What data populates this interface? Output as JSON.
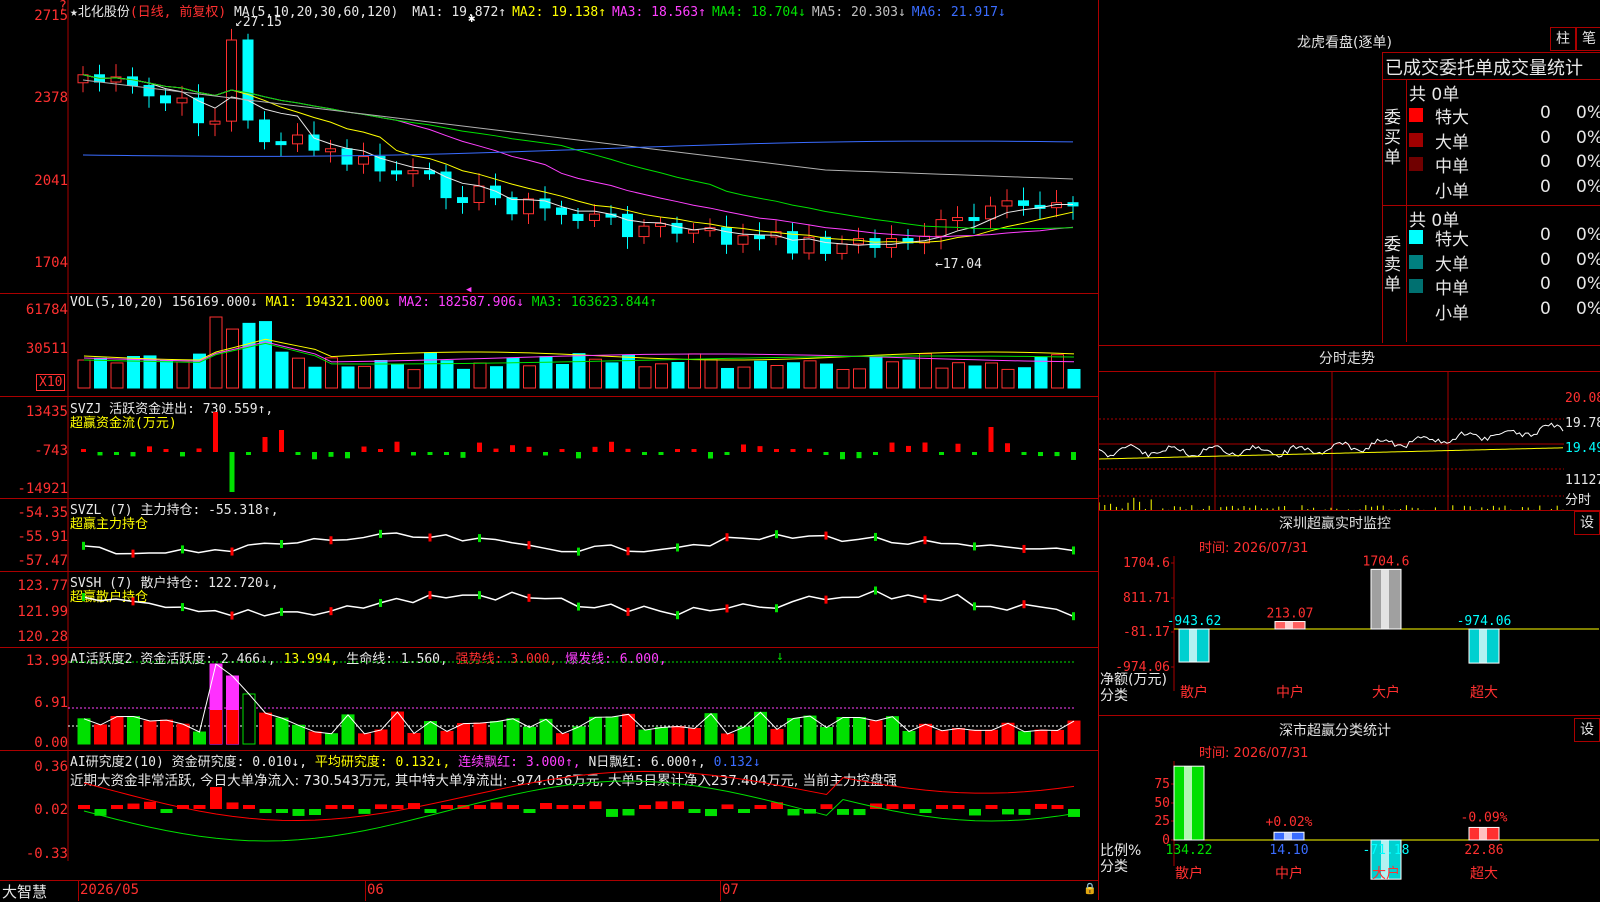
{
  "main": {
    "price_ticks": [
      "2715",
      "2378",
      "2041",
      "1704"
    ],
    "stock_name": "北化股份",
    "stock_mode": "(日线, 前复权)",
    "ma_header": "MA(5,10,20,30,60,120)",
    "ma_values": [
      {
        "label": "MA1:",
        "value": "19.872",
        "arrow": "↑",
        "color": "#e8e8e8"
      },
      {
        "label": "MA2:",
        "value": "19.138",
        "arrow": "↑",
        "color": "#ffff00"
      },
      {
        "label": "MA3:",
        "value": "18.563",
        "arrow": "↑",
        "color": "#ff40ff"
      },
      {
        "label": "MA4:",
        "value": "18.704",
        "arrow": "↓",
        "color": "#00e000"
      },
      {
        "label": "MA5:",
        "value": "20.303",
        "arrow": "↓",
        "color": "#c0c0c0"
      },
      {
        "label": "MA6:",
        "value": "21.917",
        "arrow": "↓",
        "color": "#3a6cff"
      }
    ],
    "high_label": "27.15",
    "low_label": "←17.04",
    "question_mark": "?"
  },
  "vol": {
    "ticks": [
      "61784",
      "30511"
    ],
    "unit": "X10",
    "header": "VOL(5,10,20)",
    "value": "156169.000↓",
    "ma1": "MA1: 194321.000↓",
    "ma2": "MA2: 182587.906↓",
    "ma3": "MA3: 163623.844↑"
  },
  "svzj": {
    "ticks": [
      "13435",
      "-743",
      "-14921"
    ],
    "header": "SVZJ  活跃资金进出: 730.559↑,",
    "sub": "超赢资金流(万元)"
  },
  "svzl": {
    "ticks": [
      "-54.35",
      "-55.91",
      "-57.47"
    ],
    "header": "SVZL (7) 主力持仓: -55.318↑,",
    "sub": "超赢主力持仓"
  },
  "svsh": {
    "ticks": [
      "123.77",
      "121.99",
      "120.28"
    ],
    "header": "SVSH (7) 散户持仓: 122.720↓,",
    "sub": "超赢散户持仓"
  },
  "ai1": {
    "ticks": [
      "13.99",
      "6.91",
      "0.00"
    ],
    "h1": "AI活跃度2 资金活跃度: 2.466↓,",
    "h2": "13.994,",
    "h3": "生命线: 1.560,",
    "h4": "强势线: 3.000,",
    "h5": "爆发线: 6.000,"
  },
  "ai2": {
    "ticks": [
      "0.36",
      "0.02",
      "-0.33"
    ],
    "h1": "AI研究度2(10) 资金研究度: 0.010↓,",
    "h2": "平均研究度: 0.132↓,",
    "h3": "连续飘红: 3.000↑,",
    "h4": "N日飘红: 6.000↑,",
    "h5": "0.132↓",
    "summary": "近期大资金非常活跃, 今日大单净流入: 730.543万元, 其中特大单净流出: -974.056万元, 大单5日累计净入237.404万元, 当前主力控盘强"
  },
  "bottom": {
    "brand": "大智慧",
    "dates": [
      "2026/05",
      "06",
      "07"
    ]
  },
  "dragon": {
    "title": "龙虎看盘(逐单)",
    "btn1": "柱",
    "btn2": "笔",
    "subtitle": "已成交委托单成交量统计",
    "buy_side": "委买单",
    "sell_side": "委卖单",
    "buy_total": "共 0单",
    "sell_total": "共 0单",
    "buy_rows": [
      {
        "label": "特大",
        "count": "0",
        "pct": "0%",
        "color": "#ff0000"
      },
      {
        "label": "大单",
        "count": "0",
        "pct": "0%",
        "color": "#a00000"
      },
      {
        "label": "中单",
        "count": "0",
        "pct": "0%",
        "color": "#700000"
      },
      {
        "label": "小单",
        "count": "0",
        "pct": "0%",
        "color": ""
      }
    ],
    "sell_rows": [
      {
        "label": "特大",
        "count": "0",
        "pct": "0%",
        "color": "#00ffff"
      },
      {
        "label": "大单",
        "count": "0",
        "pct": "0%",
        "color": "#008080"
      },
      {
        "label": "中单",
        "count": "0",
        "pct": "0%",
        "color": "#007070"
      },
      {
        "label": "小单",
        "count": "0",
        "pct": "0%",
        "color": ""
      }
    ]
  },
  "intraday": {
    "title": "分时走势",
    "p1": "20.08",
    "p2": "19.78",
    "p3": "19.49",
    "vol": "11127",
    "label": "分时"
  },
  "sz_monitor": {
    "title": "深圳超赢实时监控",
    "time": "时间: 2026/07/31",
    "set": "设",
    "ticks": [
      "1704.6",
      "811.71",
      "-81.17",
      "-974.06"
    ],
    "bars": [
      {
        "cat": "散户",
        "value": "-943.62"
      },
      {
        "cat": "中户",
        "value": "213.07"
      },
      {
        "cat": "大户",
        "value": "1704.6"
      },
      {
        "cat": "超大",
        "value": "-974.06"
      }
    ],
    "ylabel": "净额(万元)",
    "xlabel": "分类"
  },
  "sz_class": {
    "title": "深市超赢分类统计",
    "time": "时间: 2026/07/31",
    "set": "设",
    "ticks": [
      "75",
      "50",
      "25",
      "0"
    ],
    "bars": [
      {
        "cat": "散户",
        "value": "134.22",
        "label": ""
      },
      {
        "cat": "中户",
        "value": "14.10",
        "label": "+0.02%"
      },
      {
        "cat": "大户",
        "value": "-71.18",
        "label": ""
      },
      {
        "cat": "超大",
        "value": "22.86",
        "label": "-0.09%"
      }
    ],
    "ylabel": "比例%",
    "xlabel": "分类"
  }
}
